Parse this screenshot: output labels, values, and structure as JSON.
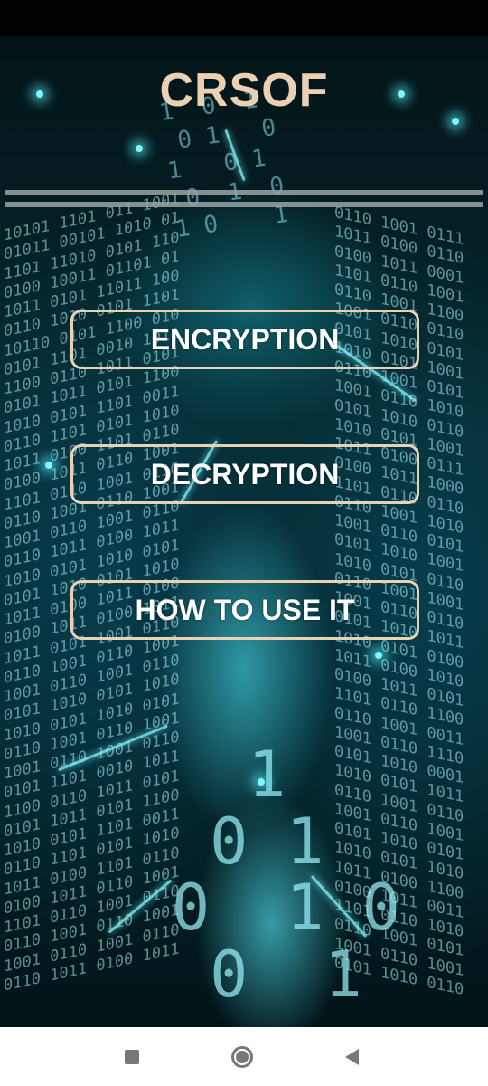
{
  "app": {
    "title": "CRSOF"
  },
  "menu": {
    "encryption_label": "ENCRYPTION",
    "decryption_label": "DECRYPTION",
    "how_to_use_label": "HOW TO USE IT"
  },
  "theme": {
    "title_color": "#ebd1b4",
    "button_border_color": "#ebd1b4",
    "button_text_color": "#ffffff",
    "background_color": "#052a30"
  },
  "navigation": {
    "recent_icon": "square-icon",
    "home_icon": "home-circle-icon",
    "back_icon": "back-triangle-icon"
  }
}
